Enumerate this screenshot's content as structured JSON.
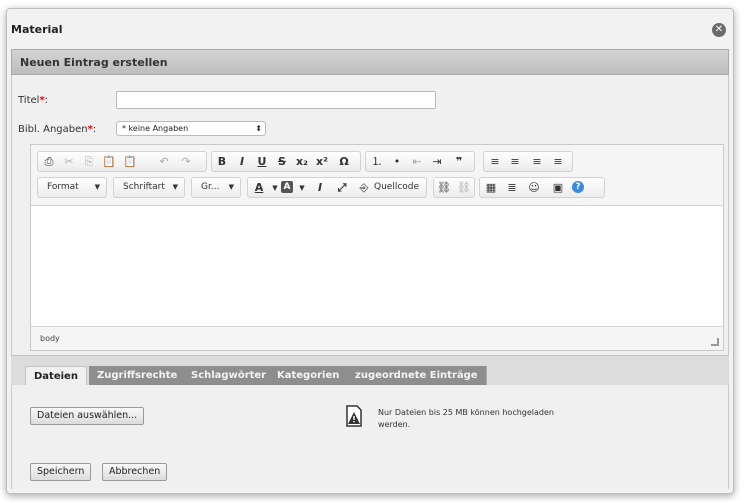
{
  "dialog": {
    "title": "Material",
    "close_glyph": "✕"
  },
  "section": {
    "title": "Neuen Eintrag erstellen"
  },
  "form": {
    "title_label": "Titel",
    "required_mark": "*",
    "colon": ":",
    "title_value": "",
    "bibl_label": "Bibl. Angaben",
    "bibl_selected": "* keine Angaben"
  },
  "toolbar": {
    "format_label": "Format",
    "font_label": "Schriftart",
    "size_label": "Gr...",
    "source_label": "Quellcode"
  },
  "editor": {
    "path": "body"
  },
  "tabs": [
    {
      "label": "Dateien"
    },
    {
      "label": "Zugriffsrechte"
    },
    {
      "label": "Schlagwörter"
    },
    {
      "label": "Kategorien"
    },
    {
      "label": "zugeordnete Einträge"
    }
  ],
  "files": {
    "choose_label": "Dateien auswählen...",
    "info_text": "Nur Dateien bis 25 MB können hochgeladen werden."
  },
  "actions": {
    "save_label": "Speichern",
    "cancel_label": "Abbrechen"
  }
}
